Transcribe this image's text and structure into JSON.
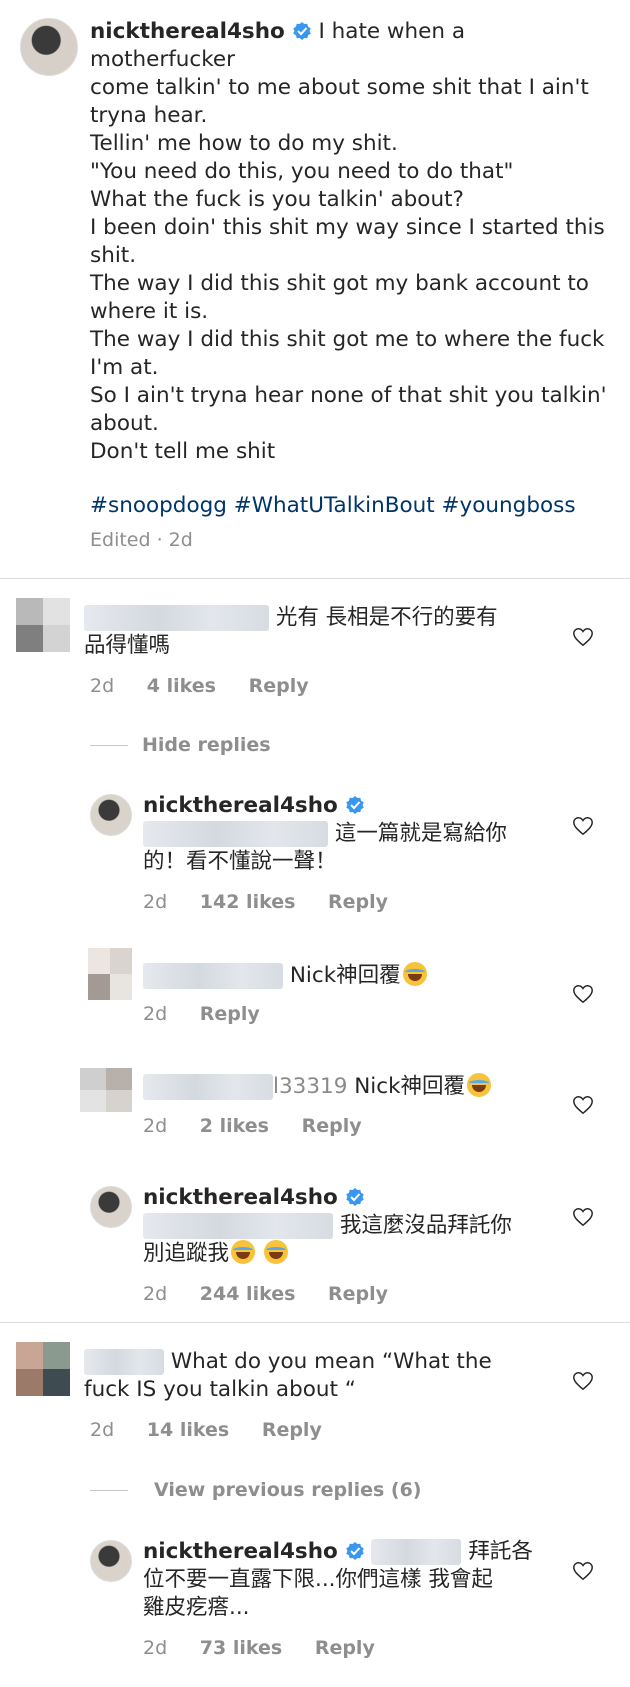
{
  "post": {
    "username": "nickthereal4sho",
    "caption_first": "I hate when a motherfucker",
    "caption_lines": [
      "come talkin' to me about some shit that I ain't",
      "tryna hear.",
      "Tellin' me how to do my shit.",
      "\"You need do this, you need to do that\"",
      "What the fuck is you talkin' about?",
      "I been doin' this shit my way since I started this",
      "shit.",
      "The way I did this shit got my bank account to",
      "where it is.",
      "The way I did this shit got me to where the fuck",
      "I'm at.",
      "So I ain't tryna hear none of that shit you talkin'",
      "about.",
      "Don't tell me shit"
    ],
    "hashtags": "#snoopdogg #WhatUTalkinBout #youngboss",
    "meta": "Edited · 2d"
  },
  "comments": [
    {
      "text_line1": "光有 長相是不行的要有",
      "text_line2": "品得懂嗎",
      "time": "2d",
      "likes": "4 likes",
      "reply": "Reply"
    },
    {
      "text_line1": "What do you mean “What the",
      "text_line2": "fuck IS you talkin about “",
      "time": "2d",
      "likes": "14 likes",
      "reply": "Reply"
    }
  ],
  "hide_replies": "Hide replies",
  "view_previous": "View previous replies (6)",
  "replies": [
    {
      "username": "nickthereal4sho",
      "text_line1": "這一篇就是寫給你",
      "text_line2": "的！看不懂說一聲！",
      "time": "2d",
      "likes": "142 likes",
      "reply": "Reply"
    },
    {
      "text": "Nick神回覆",
      "time": "2d",
      "reply": "Reply"
    },
    {
      "text_prefix": "l33319",
      "text": "Nick神回覆",
      "time": "2d",
      "likes": "2 likes",
      "reply": "Reply"
    },
    {
      "username": "nickthereal4sho",
      "text_line1": "我這麼沒品拜託你",
      "text_line2": "別追蹤我",
      "time": "2d",
      "likes": "244 likes",
      "reply": "Reply"
    },
    {
      "username": "nickthereal4sho",
      "text_line1": "拜託各",
      "text_line2": "位不要一直露下限...你們這樣 我會起",
      "text_line3": "雞皮疙瘩...",
      "time": "2d",
      "likes": "73 likes",
      "reply": "Reply"
    }
  ],
  "icons": {
    "verified": "verified-badge-icon",
    "heart": "heart-outline-icon",
    "emoji": "face-with-tears-of-joy-icon"
  },
  "colors": {
    "verified": "#3897f0",
    "hashtag": "#003569",
    "meta": "#8e8e8e"
  }
}
